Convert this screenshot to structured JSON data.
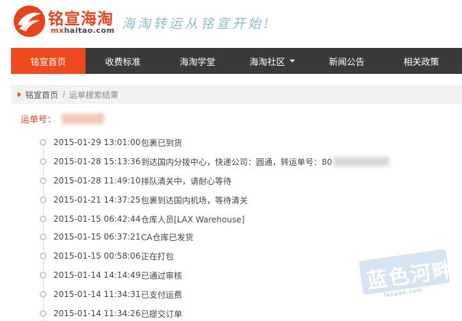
{
  "header": {
    "logo_name": "铭宣海淘",
    "logo_domain_prefix": "mx",
    "logo_domain_rest": "haitao.com",
    "slogan": "海淘转运从铭宣开始!"
  },
  "nav": {
    "items": [
      {
        "label": "铭宣首页"
      },
      {
        "label": "收费标准"
      },
      {
        "label": "海淘学堂"
      },
      {
        "label": "海淘社区"
      },
      {
        "label": "新闻公告"
      },
      {
        "label": "相关政策"
      }
    ]
  },
  "breadcrumb": {
    "home": "铭宣首页",
    "separator": "/",
    "current": "运单搜索结果"
  },
  "tracking": {
    "label": "运单号："
  },
  "timeline": [
    {
      "time": "2015-01-29 13:01:00",
      "text": "包裹已到货"
    },
    {
      "time": "2015-01-28 15:13:36",
      "text": "到达国内分拨中心，快递公司：圆通，转运单号：80"
    },
    {
      "time": "2015-01-28 11:49:10",
      "text": "排队清关中，请耐心等待"
    },
    {
      "time": "2015-01-21 14:37:25",
      "text": "包裹到达国内机场，等待清关"
    },
    {
      "time": "2015-01-15 06:42:44",
      "text": "仓库人员[LAX Warehouse]"
    },
    {
      "time": "2015-01-15 06:37:21",
      "text": "CA仓库已发货"
    },
    {
      "time": "2015-01-15 00:58:06",
      "text": "正在打包"
    },
    {
      "time": "2015-01-14 14:14:49",
      "text": "已通过审核"
    },
    {
      "time": "2015-01-14 11:34:31",
      "text": "已支付运费"
    },
    {
      "time": "2015-01-14 11:34:26",
      "text": "已提交订单"
    }
  ],
  "watermark": {
    "text": "蓝色河畔",
    "sub": "lanpan.com"
  },
  "colors": {
    "accent": "#ee4a1e",
    "nav_bg": "#3a3a3a",
    "slogan": "#8fb9d4"
  }
}
